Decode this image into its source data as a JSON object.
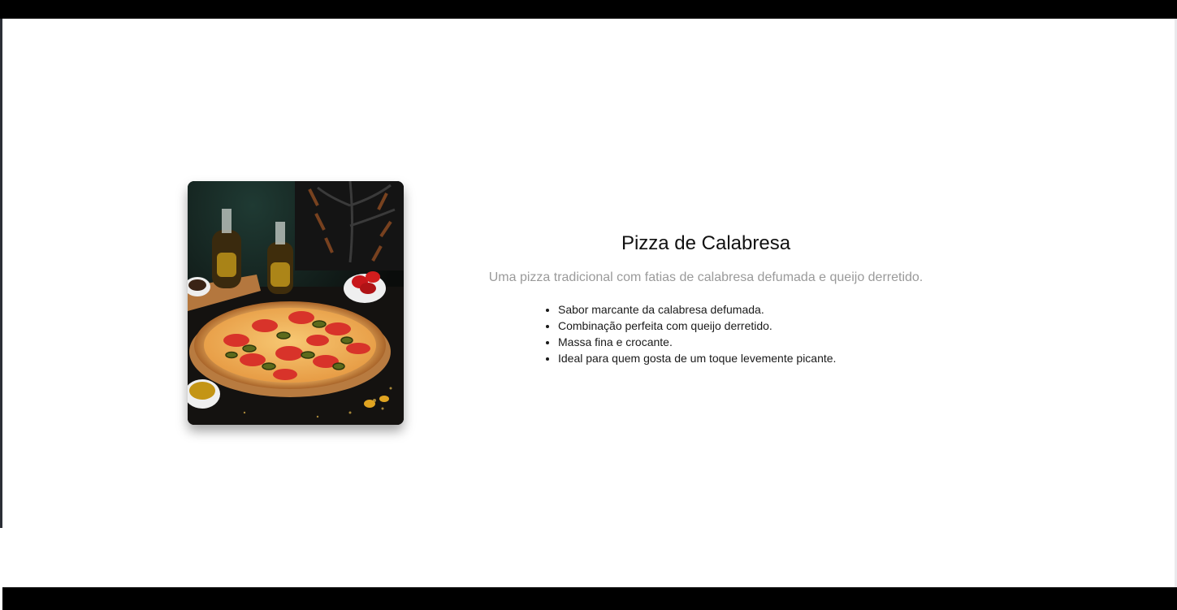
{
  "product": {
    "title": "Pizza de Calabresa",
    "description": "Uma pizza tradicional com fatias de calabresa defumada e queijo derretido.",
    "features": [
      "Sabor marcante da calabresa defumada.",
      "Combinação perfeita com queijo derretido.",
      "Massa fina e crocante.",
      "Ideal para quem gosta de um toque levemente picante."
    ],
    "image_icon": "pizza-photo"
  },
  "colors": {
    "frame": "#000000",
    "title": "#111111",
    "description": "#9a9a9a",
    "text": "#1a1a1a"
  }
}
